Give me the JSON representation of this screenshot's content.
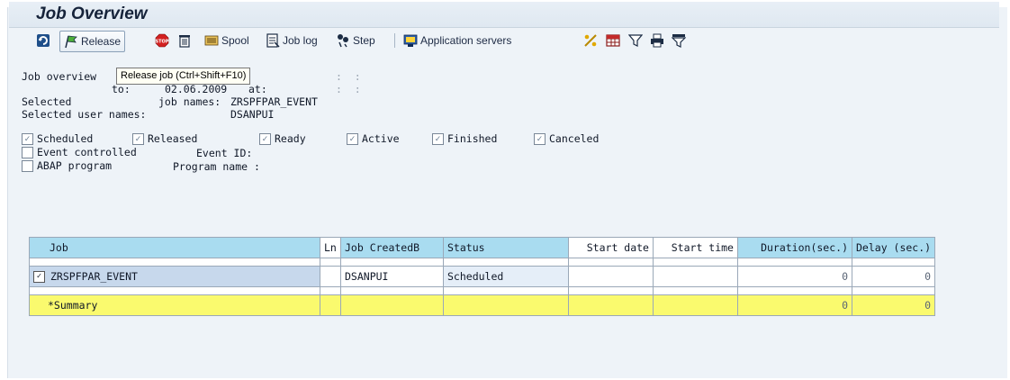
{
  "title": "Job Overview",
  "toolbar": {
    "release_label": "Release",
    "spool_label": "Spool",
    "joblog_label": "Job log",
    "step_label": "Step",
    "appservers_label": "Application servers"
  },
  "tooltip": "Release job  (Ctrl+Shift+F10)",
  "criteria": {
    "line1_prefix": "Job overview",
    "line1_time_sep": ":  :",
    "line2_to_label": "to:",
    "line2_date": "02.06.2009",
    "line2_at_label": "at:",
    "line2_time_sep": ":  :",
    "selected_label": "Selected",
    "job_names_label": "job names:",
    "job_names_value": "ZRSPFPAR_EVENT",
    "user_names_label": "Selected user names:",
    "user_names_value": "DSANPUI"
  },
  "status_filters": [
    {
      "label": "Scheduled",
      "checked": true
    },
    {
      "label": "Released",
      "checked": true
    },
    {
      "label": "Ready",
      "checked": true
    },
    {
      "label": "Active",
      "checked": true
    },
    {
      "label": "Finished",
      "checked": true
    },
    {
      "label": "Canceled",
      "checked": true
    }
  ],
  "event_controlled": {
    "label": "Event controlled",
    "checked": false,
    "event_id_label": "Event ID:"
  },
  "abap_program": {
    "label": "ABAP program",
    "checked": false,
    "program_name_label": "Program name :"
  },
  "table": {
    "headers": {
      "job": "Job",
      "ln": "Ln",
      "created_by": "Job CreatedB",
      "status": "Status",
      "start_date": "Start date",
      "start_time": "Start time",
      "duration": "Duration(sec.)",
      "delay": "Delay (sec.)"
    },
    "row": {
      "checked": true,
      "job": "ZRSPFPAR_EVENT",
      "ln": "",
      "created_by": "DSANPUI",
      "status": "Scheduled",
      "start_date": "",
      "start_time": "",
      "duration": "0",
      "delay": "0"
    },
    "summary": {
      "label": "*Summary",
      "duration": "0",
      "delay": "0"
    }
  },
  "colors": {
    "header_highlight": "#a9dcf0",
    "summary_row": "#fafa6e",
    "selected_job_cell": "#c7d8ec"
  }
}
